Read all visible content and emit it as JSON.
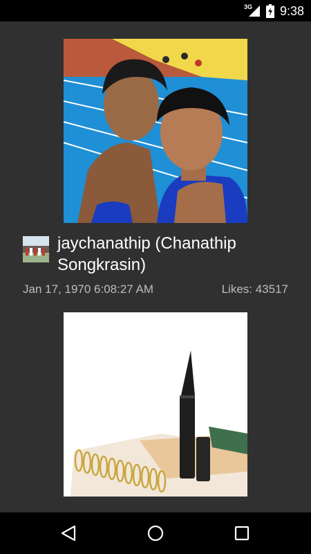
{
  "status_bar": {
    "network_type": "3G",
    "time": "9:38",
    "icons": [
      "signal-icon",
      "battery-icon"
    ]
  },
  "post": {
    "username": "jaychanathip (Chanathip Songkrasin)",
    "date": "Jan 17, 1970 6:08:27 AM",
    "likes": "Likes: 43517"
  },
  "navigation": {
    "icons": [
      "back-icon",
      "home-icon",
      "recents-icon"
    ]
  },
  "colors": {
    "background": "#303030",
    "status_bar": "#000000",
    "nav_bar": "#000000",
    "text_primary": "#ffffff",
    "text_secondary": "#bdbdbd"
  }
}
